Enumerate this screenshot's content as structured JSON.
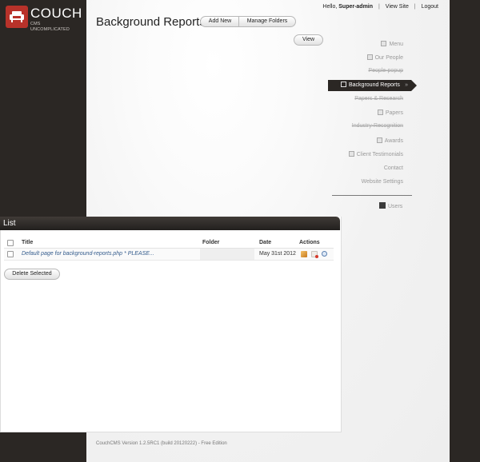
{
  "brand": {
    "name": "COUCH",
    "tagline": "CMS UNCOMPLICATED"
  },
  "userbar": {
    "greeting": "Hello,",
    "username": "Super-admin",
    "view_site": "View Site",
    "logout": "Logout"
  },
  "header": {
    "title": "Background Reports",
    "add_new": "Add New",
    "manage_folders": "Manage Folders",
    "view": "View"
  },
  "nav": {
    "items": [
      {
        "label": "Menu",
        "icon": "page-icon"
      },
      {
        "label": "Our People",
        "icon": "page-icon"
      },
      {
        "label": "People-popup",
        "icon": ""
      },
      {
        "label": "Background Reports",
        "icon": "page-icon",
        "active": true
      },
      {
        "label": "Papers & Research",
        "icon": ""
      },
      {
        "label": "Papers",
        "icon": "page-icon"
      },
      {
        "label": "Industry-Recognition",
        "icon": ""
      },
      {
        "label": "Awards",
        "icon": "page-icon"
      },
      {
        "label": "Client Testimonials",
        "icon": "page-icon"
      },
      {
        "label": "Contact",
        "icon": ""
      },
      {
        "label": "Website Settings",
        "icon": ""
      }
    ],
    "users": "Users"
  },
  "list": {
    "heading": "List",
    "columns": [
      "Title",
      "Folder",
      "Date",
      "Actions"
    ],
    "rows": [
      {
        "title": "Default page for background-reports.php * PLEASE...",
        "folder": "",
        "date": "May 31st 2012"
      }
    ],
    "delete_selected": "Delete Selected"
  },
  "footer": {
    "text": "CouchCMS Version 1.2.5RC1 (build 20120222) - Free Edition"
  },
  "colors": {
    "dark": "#2b2724",
    "brand_red": "#b8322a",
    "link": "#335b8c"
  }
}
